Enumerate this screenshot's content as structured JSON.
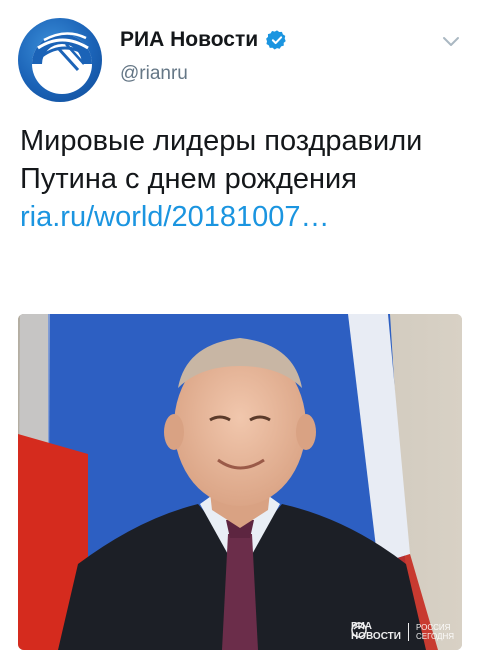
{
  "account": {
    "display_name": "РИА Новости",
    "handle": "@rianru",
    "verified": true,
    "avatar_icon": "ria-novosti-logo-icon",
    "brand_color": "#1b63b7"
  },
  "tweet": {
    "text": "Мировые лидеры поздравили Путина с днем рождения",
    "link": "ria.ru/world/20181007…",
    "link_color": "#1b95e0"
  },
  "media": {
    "watermark": {
      "line1": "РИА",
      "line2": "НОВОСТИ",
      "line3": "РОССИЯ",
      "line4": "СЕГОДНЯ"
    }
  },
  "icons": {
    "verified": "verified-badge-icon",
    "menu": "chevron-down-icon"
  }
}
